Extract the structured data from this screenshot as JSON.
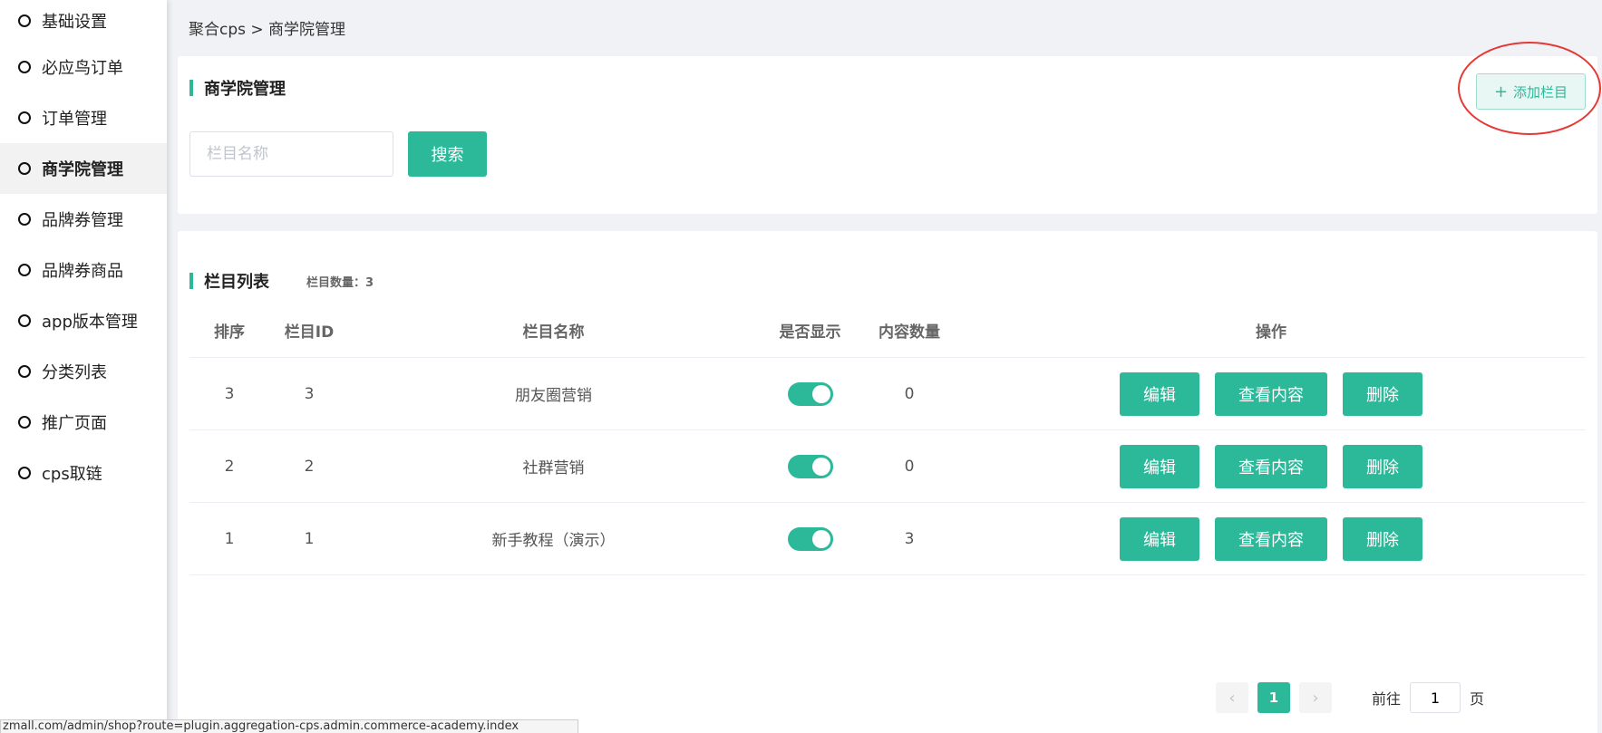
{
  "sidebar": {
    "items": [
      {
        "label": "基础设置"
      },
      {
        "label": "必应鸟订单"
      },
      {
        "label": "订单管理"
      },
      {
        "label": "商学院管理",
        "active": true
      },
      {
        "label": "品牌券管理"
      },
      {
        "label": "品牌券商品"
      },
      {
        "label": "app版本管理"
      },
      {
        "label": "分类列表"
      },
      {
        "label": "推广页面"
      },
      {
        "label": "cps取链"
      }
    ]
  },
  "breadcrumb": "聚合cps > 商学院管理",
  "top_card": {
    "title": "商学院管理",
    "add_button": {
      "icon": "plus-icon",
      "label": "添加栏目"
    },
    "search": {
      "placeholder": "栏目名称",
      "value": ""
    },
    "search_button": "搜索"
  },
  "list_card": {
    "title": "栏目列表",
    "count_label": "栏目数量：3",
    "columns": [
      "排序",
      "栏目ID",
      "栏目名称",
      "是否显示",
      "内容数量",
      "操作"
    ],
    "rows": [
      {
        "sort": "3",
        "id": "3",
        "name": "朋友圈营销",
        "visible": true,
        "content_count": "0"
      },
      {
        "sort": "2",
        "id": "2",
        "name": "社群营销",
        "visible": true,
        "content_count": "0"
      },
      {
        "sort": "1",
        "id": "1",
        "name": "新手教程（演示）",
        "visible": true,
        "content_count": "3"
      }
    ],
    "actions": {
      "edit": "编辑",
      "view": "查看内容",
      "delete": "删除"
    }
  },
  "pagination": {
    "current": "1",
    "goto_prefix": "前往",
    "goto_value": "1",
    "goto_suffix": "页"
  },
  "status_url": "zmall.com/admin/shop?route=plugin.aggregation-cps.admin.commerce-academy.index",
  "colors": {
    "accent": "#2bb99a",
    "annotation": "#e53935"
  }
}
